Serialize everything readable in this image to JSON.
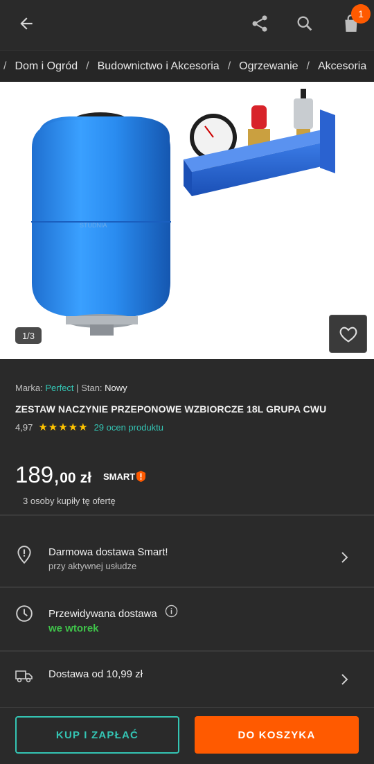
{
  "header": {
    "back_icon": "arrow-left-icon",
    "share_icon": "share-icon",
    "search_icon": "search-icon",
    "cart_icon": "shopping-bag-icon",
    "cart_count": "1"
  },
  "breadcrumbs": [
    "Dom i Ogród",
    "Budownictwo i Akcesoria",
    "Ogrzewanie",
    "Akcesoria"
  ],
  "gallery": {
    "counter": "1/3",
    "tank_label": "STUDNIA",
    "favorite_icon": "heart-icon"
  },
  "product": {
    "brand_label": "Marka:",
    "brand": "Perfect",
    "separator": "|",
    "condition_label": "Stan:",
    "condition": "Nowy",
    "title": "ZESTAW NACZYNIE PRZEPONOWE WZBIORCZE 18L GRUPA CWU",
    "rating": "4,97",
    "stars": "★★★★★",
    "rating_count": "29 ocen produktu",
    "price_int": "189,",
    "price_dec": "00",
    "currency": "zł",
    "smart_label": "SMART",
    "buyers": "3 osoby kupiły tę ofertę"
  },
  "delivery": {
    "smart_title": "Darmowa dostawa Smart!",
    "smart_sub": "przy aktywnej usłudze",
    "expected_title": "Przewidywana dostawa",
    "expected_value": "we wtorek",
    "cost_title": "Dostawa od 10,99 zł"
  },
  "actions": {
    "buy_now": "KUP I ZAPŁAĆ",
    "add_to_cart": "DO KOSZYKA"
  },
  "colors": {
    "accent_teal": "#34c5b4",
    "accent_orange": "#ff5a00",
    "green": "#3fc24a",
    "star": "#ffc400",
    "background": "#2a2a2a"
  }
}
